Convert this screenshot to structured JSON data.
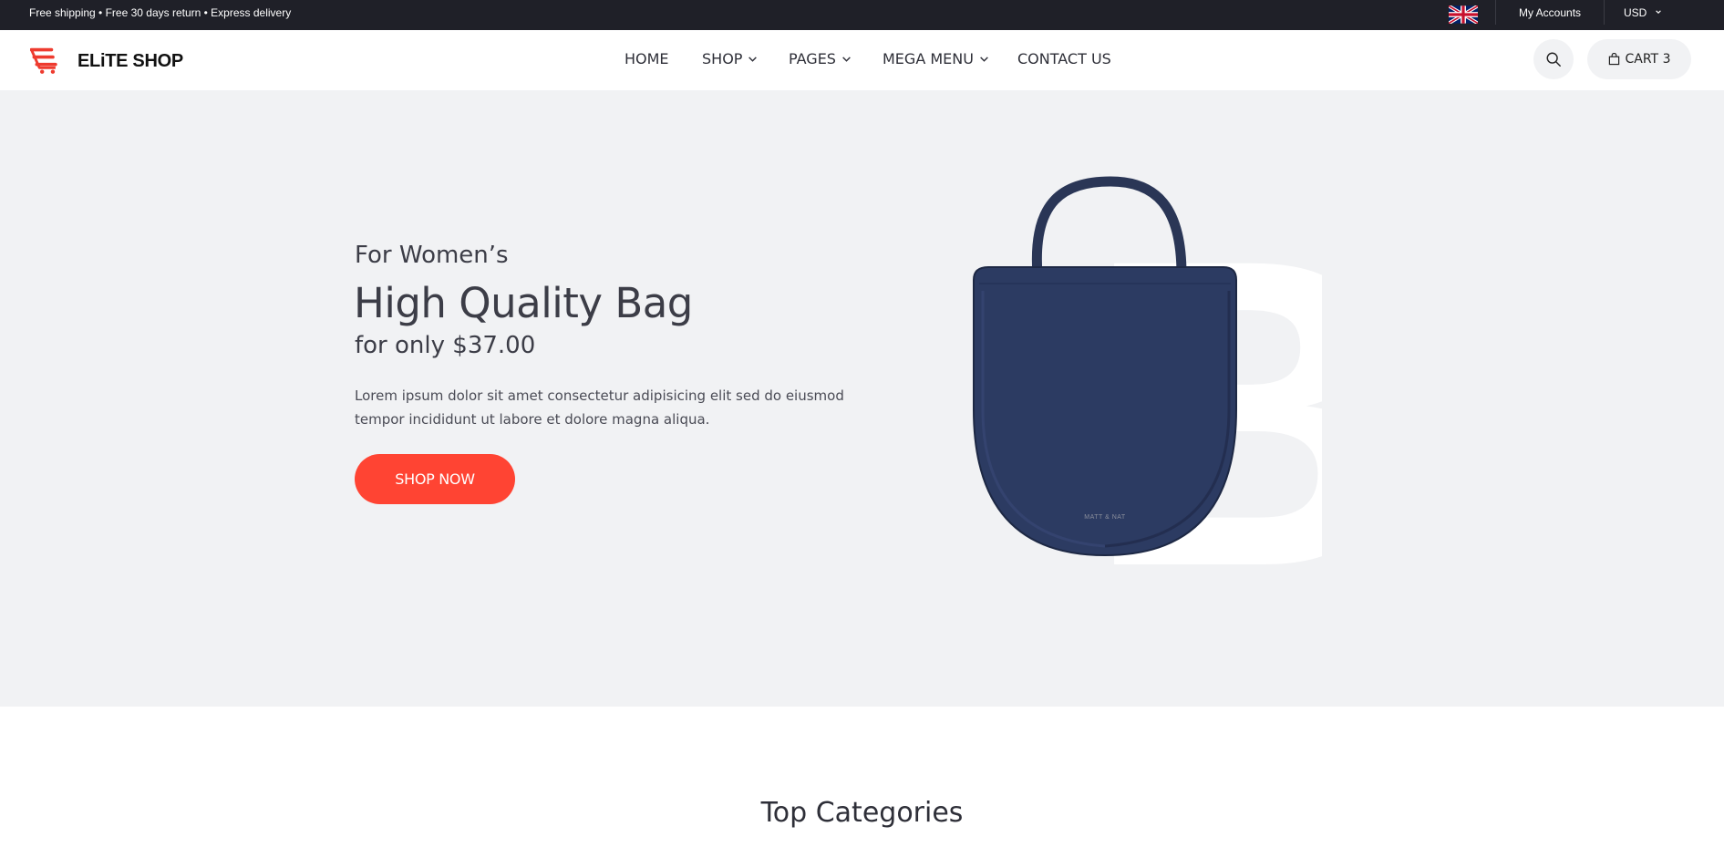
{
  "topbar": {
    "promo": "Free shipping • Free 30 days return • Express delivery",
    "language_flag": "uk-flag-icon",
    "accounts_label": "My Accounts",
    "currency": "USD"
  },
  "header": {
    "logo_text": "ELiTE SHOP",
    "nav": [
      {
        "label": "HOME",
        "has_dropdown": false
      },
      {
        "label": "SHOP",
        "has_dropdown": true
      },
      {
        "label": "PAGES",
        "has_dropdown": true
      },
      {
        "label": "MEGA MENU",
        "has_dropdown": true
      },
      {
        "label": "CONTACT US",
        "has_dropdown": false
      }
    ],
    "search_icon": "search-icon",
    "cart_label": "CART 3"
  },
  "hero": {
    "subtitle": "For Women’s",
    "title": "High Quality Bag",
    "price_line": "for only $37.00",
    "description": "Lorem ipsum dolor sit amet consectetur adipisicing elit sed do eiusmod tempor incididunt ut labore et dolore magna aliqua.",
    "cta_label": "SHOP NOW",
    "background_letter": "B",
    "bag_brand_text": "MATT & NAT"
  },
  "categories": {
    "title": "Top Categories"
  },
  "colors": {
    "topbar_bg": "#1f2028",
    "hero_bg": "#f1f2f4",
    "accent": "#ff4433",
    "bag": "#2c3b62"
  }
}
